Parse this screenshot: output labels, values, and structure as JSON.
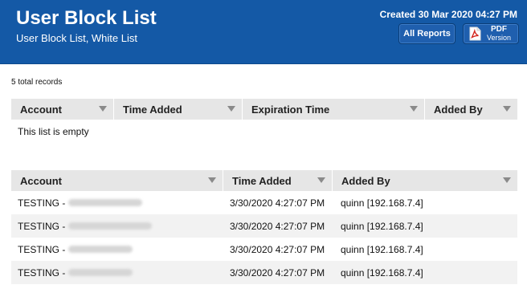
{
  "header": {
    "title": "User Block List",
    "subtitle": "User Block List, White List",
    "created": "Created 30 Mar 2020 04:27 PM",
    "all_reports_label": "All Reports",
    "pdf_label": "PDF",
    "pdf_sub_label": "Version",
    "background_color": "#1459a6"
  },
  "summary": {
    "total_records": "5 total records"
  },
  "block_table": {
    "columns": [
      "Account",
      "Time Added",
      "Expiration Time",
      "Added By"
    ],
    "empty_message": "This list is empty"
  },
  "white_table": {
    "columns": [
      "Account",
      "Time Added",
      "Added By"
    ],
    "rows": [
      {
        "account": "TESTING -",
        "time_added": "3/30/2020 4:27:07 PM",
        "added_by": "quinn [192.168.7.4]"
      },
      {
        "account": "TESTING -",
        "time_added": "3/30/2020 4:27:07 PM",
        "added_by": "quinn [192.168.7.4]"
      },
      {
        "account": "TESTING -",
        "time_added": "3/30/2020 4:27:07 PM",
        "added_by": "quinn [192.168.7.4]"
      },
      {
        "account": "TESTING -",
        "time_added": "3/30/2020 4:27:07 PM",
        "added_by": "quinn [192.168.7.4]"
      }
    ]
  },
  "icons": {
    "sort": "sort-desc-icon",
    "pdf": "pdf-file-icon"
  }
}
